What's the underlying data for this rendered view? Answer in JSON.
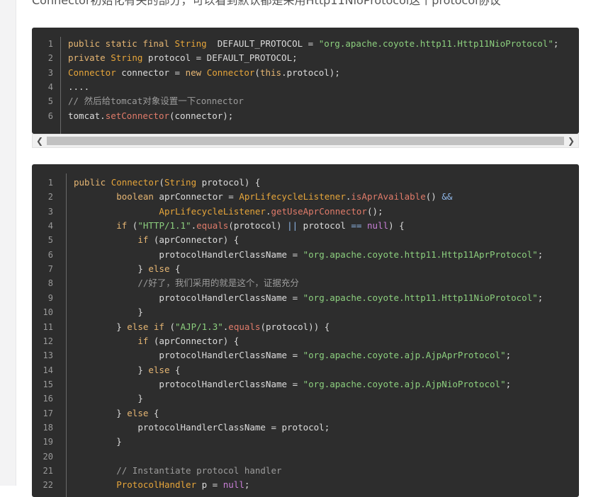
{
  "article": {
    "intro_text": "Connector初始化有关的部分，可以看到默认都是采用Http11NioProtocol这个protocol协议"
  },
  "code_block_1": {
    "lines": [
      {
        "n": "1",
        "indent": "",
        "tokens": [
          [
            "kw",
            "public static final "
          ],
          [
            "ty",
            "String"
          ],
          [
            "",
            "  DEFAULT_PROTOCOL = "
          ],
          [
            "str",
            "\"org.apache.coyote.http11.Http11NioProtocol\""
          ],
          [
            "",
            ";"
          ]
        ]
      },
      {
        "n": "2",
        "indent": "",
        "tokens": [
          [
            "kw",
            "private "
          ],
          [
            "ty",
            "String"
          ],
          [
            "",
            " protocol = DEFAULT_PROTOCOL;"
          ]
        ]
      },
      {
        "n": "3",
        "indent": "",
        "tokens": [
          [
            "ty",
            "Connector"
          ],
          [
            "",
            " connector = "
          ],
          [
            "kw",
            "new "
          ],
          [
            "ty",
            "Connector"
          ],
          [
            "",
            "("
          ],
          [
            "kw",
            "this"
          ],
          [
            "",
            ".protocol);"
          ]
        ]
      },
      {
        "n": "4",
        "indent": "",
        "tokens": [
          [
            "",
            "...."
          ]
        ]
      },
      {
        "n": "5",
        "indent": "",
        "tokens": [
          [
            "cm",
            "// 然后给tomcat对象设置一下connector"
          ]
        ]
      },
      {
        "n": "6",
        "indent": "",
        "tokens": [
          [
            "",
            "tomcat."
          ],
          [
            "fn",
            "setConnector"
          ],
          [
            "",
            "(connector);"
          ]
        ]
      }
    ]
  },
  "scrollbar": {
    "left_arrow": "❮",
    "right_arrow": "❯"
  },
  "code_block_2": {
    "lines": [
      {
        "n": "1",
        "indent": "",
        "tokens": [
          [
            "kw",
            "public "
          ],
          [
            "ty",
            "Connector"
          ],
          [
            "",
            "("
          ],
          [
            "ty",
            "String"
          ],
          [
            "",
            " protocol) {"
          ]
        ]
      },
      {
        "n": "2",
        "indent": "        ",
        "tokens": [
          [
            "kw",
            "boolean"
          ],
          [
            "",
            " aprConnector = "
          ],
          [
            "ty",
            "AprLifecycleListener"
          ],
          [
            "",
            "."
          ],
          [
            "fn",
            "isAprAvailable"
          ],
          [
            "",
            "() "
          ],
          [
            "op",
            "&&"
          ]
        ]
      },
      {
        "n": "3",
        "indent": "                ",
        "tokens": [
          [
            "ty",
            "AprLifecycleListener"
          ],
          [
            "",
            "."
          ],
          [
            "fn",
            "getUseAprConnector"
          ],
          [
            "",
            "();"
          ]
        ]
      },
      {
        "n": "4",
        "indent": "        ",
        "tokens": [
          [
            "kw",
            "if"
          ],
          [
            "",
            " ("
          ],
          [
            "str",
            "\"HTTP/1.1\""
          ],
          [
            "",
            "."
          ],
          [
            "fn",
            "equals"
          ],
          [
            "",
            "(protocol) "
          ],
          [
            "op",
            "||"
          ],
          [
            "",
            " protocol "
          ],
          [
            "op",
            "=="
          ],
          [
            "",
            " "
          ],
          [
            "lit",
            "null"
          ],
          [
            "",
            ") {"
          ]
        ]
      },
      {
        "n": "5",
        "indent": "            ",
        "tokens": [
          [
            "kw",
            "if"
          ],
          [
            "",
            " (aprConnector) {"
          ]
        ]
      },
      {
        "n": "6",
        "indent": "                ",
        "tokens": [
          [
            "",
            "protocolHandlerClassName = "
          ],
          [
            "str",
            "\"org.apache.coyote.http11.Http11AprProtocol\""
          ],
          [
            "",
            ";"
          ]
        ]
      },
      {
        "n": "7",
        "indent": "            ",
        "tokens": [
          [
            "",
            "} "
          ],
          [
            "kw",
            "else"
          ],
          [
            "",
            " {"
          ]
        ]
      },
      {
        "n": "8",
        "indent": "            ",
        "tokens": [
          [
            "cm",
            "//好了，我们采用的就是这个，证据充分"
          ]
        ]
      },
      {
        "n": "9",
        "indent": "                ",
        "tokens": [
          [
            "",
            "protocolHandlerClassName = "
          ],
          [
            "str",
            "\"org.apache.coyote.http11.Http11NioProtocol\""
          ],
          [
            "",
            ";"
          ]
        ]
      },
      {
        "n": "10",
        "indent": "            ",
        "tokens": [
          [
            "",
            "}"
          ]
        ]
      },
      {
        "n": "11",
        "indent": "        ",
        "tokens": [
          [
            "",
            "} "
          ],
          [
            "kw",
            "else if"
          ],
          [
            "",
            " ("
          ],
          [
            "str",
            "\"AJP/1.3\""
          ],
          [
            "",
            "."
          ],
          [
            "fn",
            "equals"
          ],
          [
            "",
            "(protocol)) {"
          ]
        ]
      },
      {
        "n": "12",
        "indent": "            ",
        "tokens": [
          [
            "kw",
            "if"
          ],
          [
            "",
            " (aprConnector) {"
          ]
        ]
      },
      {
        "n": "13",
        "indent": "                ",
        "tokens": [
          [
            "",
            "protocolHandlerClassName = "
          ],
          [
            "str",
            "\"org.apache.coyote.ajp.AjpAprProtocol\""
          ],
          [
            "",
            ";"
          ]
        ]
      },
      {
        "n": "14",
        "indent": "            ",
        "tokens": [
          [
            "",
            "} "
          ],
          [
            "kw",
            "else"
          ],
          [
            "",
            " {"
          ]
        ]
      },
      {
        "n": "15",
        "indent": "                ",
        "tokens": [
          [
            "",
            "protocolHandlerClassName = "
          ],
          [
            "str",
            "\"org.apache.coyote.ajp.AjpNioProtocol\""
          ],
          [
            "",
            ";"
          ]
        ]
      },
      {
        "n": "16",
        "indent": "            ",
        "tokens": [
          [
            "",
            "}"
          ]
        ]
      },
      {
        "n": "17",
        "indent": "        ",
        "tokens": [
          [
            "",
            "} "
          ],
          [
            "kw",
            "else"
          ],
          [
            "",
            " {"
          ]
        ]
      },
      {
        "n": "18",
        "indent": "            ",
        "tokens": [
          [
            "",
            "protocolHandlerClassName = protocol;"
          ]
        ]
      },
      {
        "n": "19",
        "indent": "        ",
        "tokens": [
          [
            "",
            "}"
          ]
        ]
      },
      {
        "n": "20",
        "indent": "",
        "tokens": []
      },
      {
        "n": "21",
        "indent": "        ",
        "tokens": [
          [
            "cm",
            "// Instantiate protocol handler"
          ]
        ]
      },
      {
        "n": "22",
        "indent": "        ",
        "tokens": [
          [
            "ty",
            "ProtocolHandler"
          ],
          [
            "",
            " p = "
          ],
          [
            "lit",
            "null"
          ],
          [
            "",
            ";"
          ]
        ]
      }
    ]
  }
}
